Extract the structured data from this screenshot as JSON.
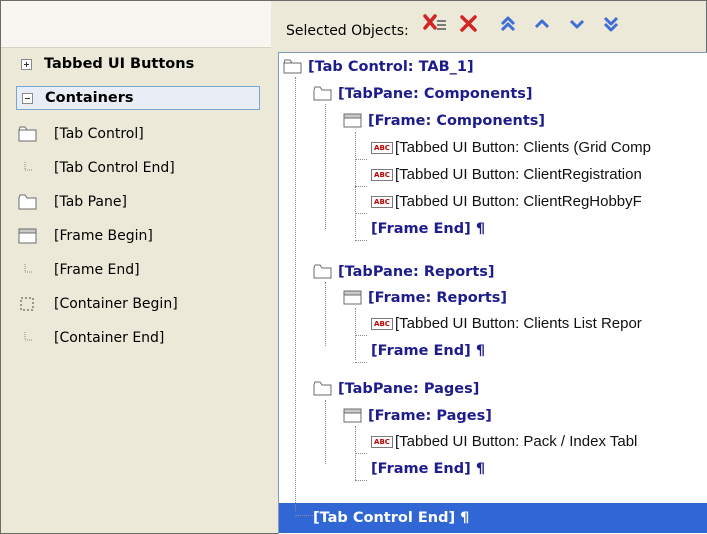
{
  "left_panel": {
    "groups": [
      {
        "label": "Tabbed UI Buttons",
        "state": "collapsed"
      },
      {
        "label": "Containers",
        "state": "expanded"
      }
    ],
    "items": [
      {
        "label": "[Tab Control]",
        "icon": "tab-folder-icon"
      },
      {
        "label": "[Tab Control End]",
        "icon": "end-marker-icon"
      },
      {
        "label": "[Tab Pane]",
        "icon": "tab-folder-icon"
      },
      {
        "label": "[Frame Begin]",
        "icon": "frame-icon"
      },
      {
        "label": "[Frame End]",
        "icon": "end-marker-icon"
      },
      {
        "label": "[Container Begin]",
        "icon": "container-icon"
      },
      {
        "label": "[Container End]",
        "icon": "end-marker-icon"
      }
    ]
  },
  "toolbar": {
    "selected_label": "Selected Objects:",
    "buttons": [
      {
        "name": "delete-all-icon",
        "color": "#d42424"
      },
      {
        "name": "delete-icon",
        "color": "#d42424"
      },
      {
        "name": "move-top-icon",
        "color": "#3f6fd6"
      },
      {
        "name": "move-up-icon",
        "color": "#3f6fd6"
      },
      {
        "name": "move-down-icon",
        "color": "#3f6fd6"
      },
      {
        "name": "move-bottom-icon",
        "color": "#3f6fd6"
      }
    ]
  },
  "tree": {
    "nodes": [
      {
        "label": "[Tab Control: TAB_1]",
        "style": "bold"
      },
      {
        "label": "[TabPane: Components]",
        "style": "bold"
      },
      {
        "label": "[Frame: Components]",
        "style": "bold"
      },
      {
        "label": "[Tabbed UI Button: Clients (Grid Comp",
        "style": "normal"
      },
      {
        "label": "[Tabbed UI Button: ClientRegistration",
        "style": "normal"
      },
      {
        "label": "[Tabbed UI Button: ClientRegHobbyF",
        "style": "normal"
      },
      {
        "label": "[Frame End] ¶",
        "style": "bold"
      },
      {
        "label": "[TabPane: Reports]",
        "style": "bold"
      },
      {
        "label": "[Frame: Reports]",
        "style": "bold"
      },
      {
        "label": "[Tabbed UI Button: Clients List Repor",
        "style": "normal"
      },
      {
        "label": "[Frame End] ¶",
        "style": "bold"
      },
      {
        "label": "[TabPane: Pages]",
        "style": "bold"
      },
      {
        "label": "[Frame: Pages]",
        "style": "bold"
      },
      {
        "label": "[Tabbed UI Button: Pack / Index Tabl",
        "style": "normal"
      },
      {
        "label": "[Frame End] ¶",
        "style": "bold"
      },
      {
        "label": "[Tab Control End] ¶",
        "style": "selected"
      }
    ],
    "abc_badge": "ABC",
    "selection_color": "#3167d4"
  }
}
